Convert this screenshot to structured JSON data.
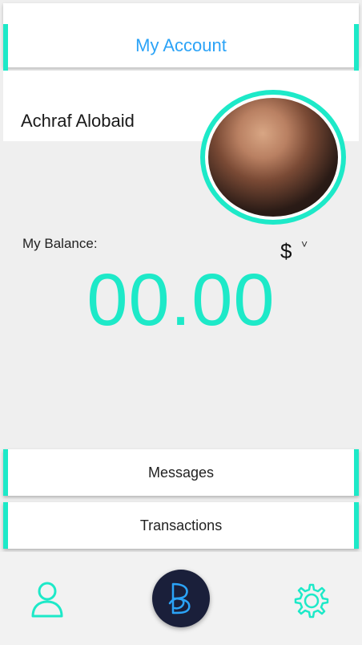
{
  "header": {
    "title": "My Account"
  },
  "profile": {
    "name": "Achraf Alobaid"
  },
  "balance": {
    "label": "My Balance:",
    "currency_symbol": "$",
    "currency_caret": "˅",
    "amount": "00.00"
  },
  "menu": {
    "messages": "Messages",
    "transactions": "Transactions"
  },
  "tabbar": {
    "left_icon": "profile-icon",
    "center_icon": "brand-b-logo-icon",
    "right_icon": "settings-gear-icon"
  },
  "colors": {
    "accent": "#1de9c8",
    "title_blue": "#2ba3f7",
    "background": "#efefef",
    "home_button": "#1a1f3a"
  }
}
